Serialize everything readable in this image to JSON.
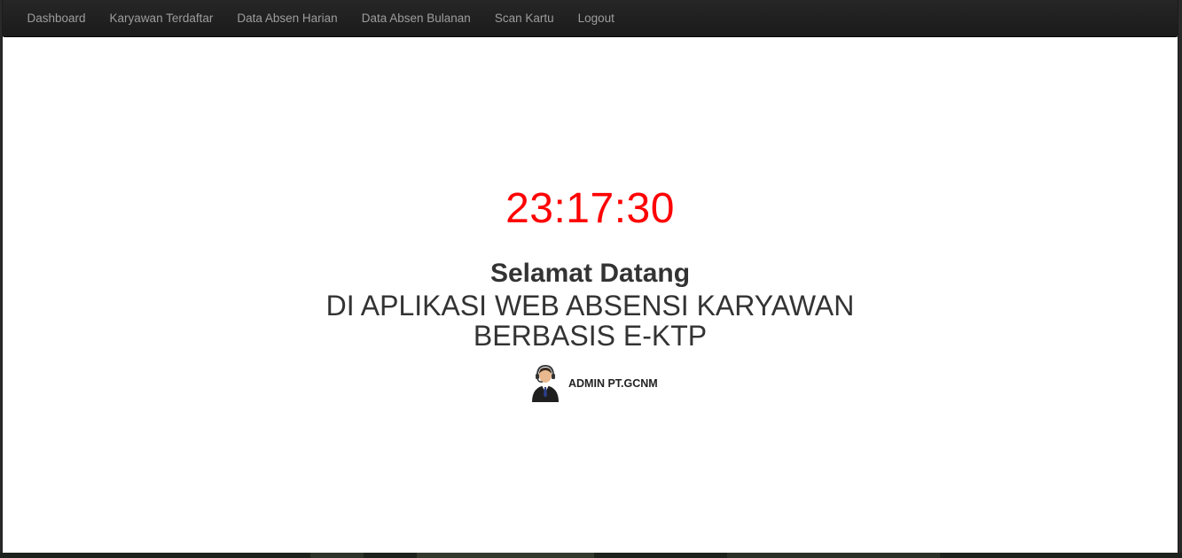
{
  "navbar": {
    "items": [
      {
        "label": "Dashboard"
      },
      {
        "label": "Karyawan Terdaftar"
      },
      {
        "label": "Data Absen Harian"
      },
      {
        "label": "Data Absen Bulanan"
      },
      {
        "label": "Scan Kartu"
      },
      {
        "label": "Logout"
      }
    ]
  },
  "main": {
    "clock": "23:17:30",
    "welcome": "Selamat Datang",
    "subtitle_line1": "DI APLIKASI WEB ABSENSI KARYAWAN",
    "subtitle_line2": "BERBASIS E-KTP",
    "user_label": "ADMIN PT.GCNM",
    "avatar_icon": "user-avatar-icon"
  },
  "colors": {
    "navbar_bg": "#222222",
    "nav_text": "#9d9d9d",
    "clock": "#ff0000",
    "text": "#333333"
  }
}
